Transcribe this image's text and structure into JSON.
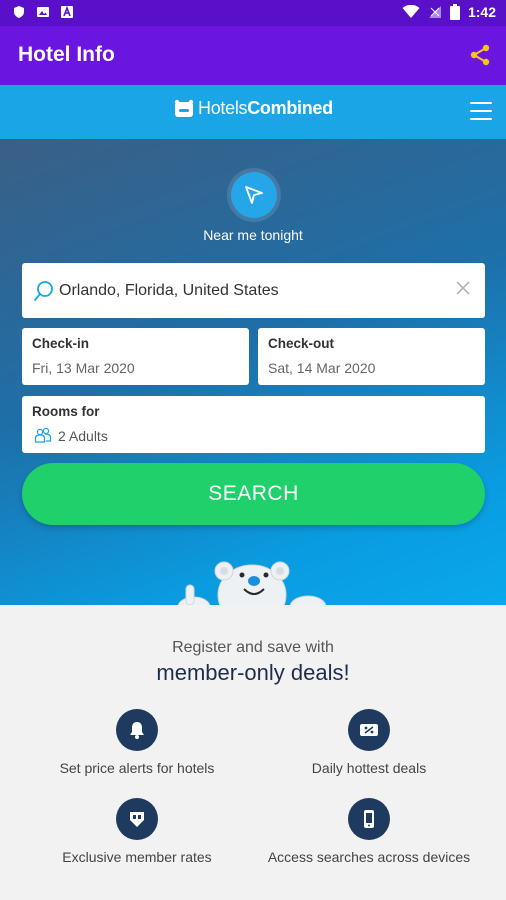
{
  "status_bar": {
    "time": "1:42"
  },
  "app_bar": {
    "title": "Hotel Info"
  },
  "brand": {
    "name_part1": "Hotels",
    "name_part2": "Combined"
  },
  "hero": {
    "near_me_label": "Near me tonight",
    "destination_value": "Orlando, Florida, United States",
    "checkin_label": "Check-in",
    "checkin_value": "Fri, 13 Mar 2020",
    "checkout_label": "Check-out",
    "checkout_value": "Sat, 14 Mar 2020",
    "rooms_label": "Rooms for",
    "rooms_value": "2 Adults",
    "search_label": "SEARCH"
  },
  "member": {
    "register_text": "Register and save with",
    "deals_text": "member-only deals!",
    "features": [
      {
        "label": "Set price alerts for hotels",
        "icon": "bell-icon"
      },
      {
        "label": "Daily hottest deals",
        "icon": "percent-ticket-icon"
      },
      {
        "label": "Exclusive member rates",
        "icon": "tag-icon"
      },
      {
        "label": "Access searches across devices",
        "icon": "phone-icon"
      }
    ]
  },
  "colors": {
    "status_bar": "#5a0fc8",
    "app_bar": "#6a15e0",
    "brand_bar": "#1aa6e6",
    "search_button": "#1fd06b",
    "share_icon": "#f5c518",
    "feature_circle": "#1f3a5f"
  }
}
